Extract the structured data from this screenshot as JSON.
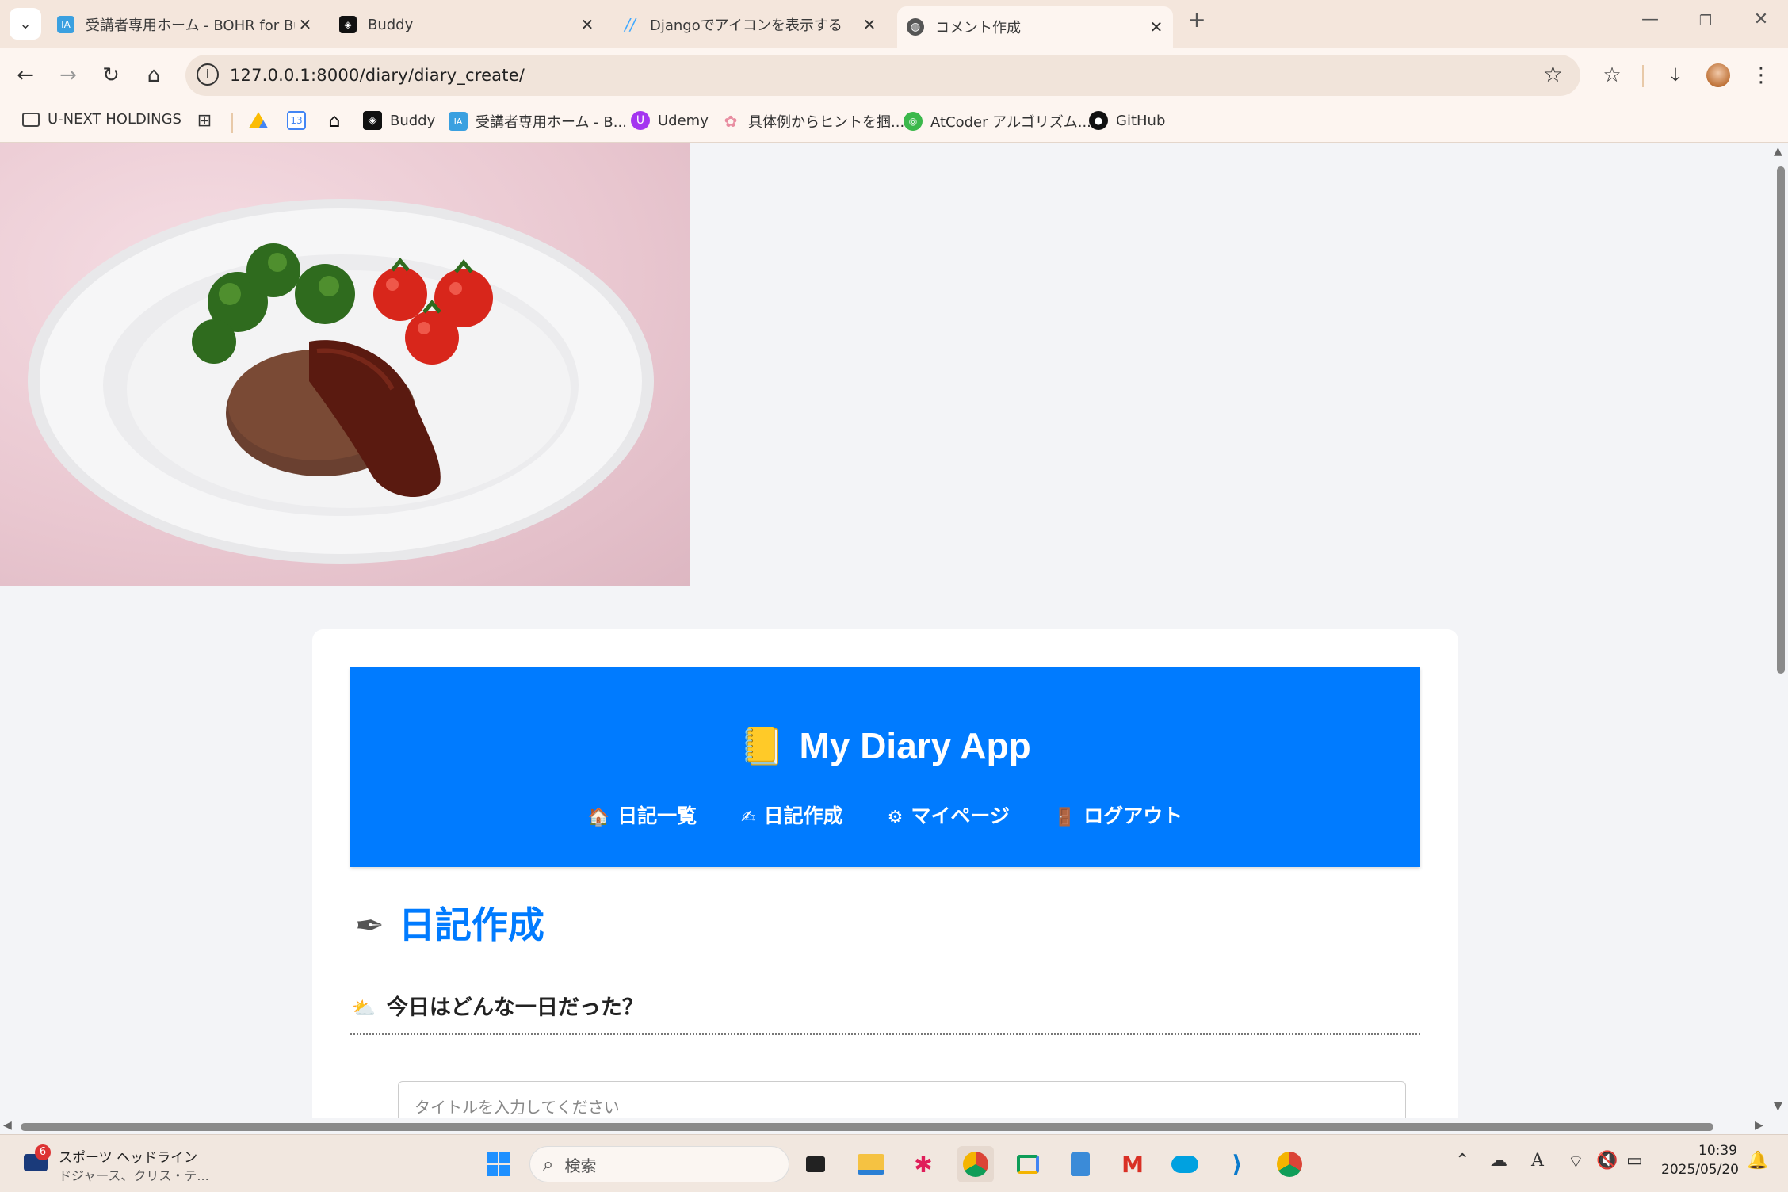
{
  "browser": {
    "tabs": [
      {
        "label": "受講者専用ホーム - BOHR for Bu",
        "favicon": "IA"
      },
      {
        "label": "Buddy",
        "favicon": "buddy-logo"
      },
      {
        "label": "Djangoでアイコンを表示する",
        "favicon": "zenn-logo"
      },
      {
        "label": "コメント作成",
        "favicon": "globe-icon"
      }
    ],
    "new_tab": "+",
    "url": "127.0.0.1:8000/diary/diary_create/",
    "bookmarks": [
      {
        "label": "U-NEXT HOLDINGS",
        "icon": "folder-icon"
      },
      {
        "label": "",
        "icon": "apps-grid-icon"
      },
      {
        "label": "",
        "icon": "google-drive-icon"
      },
      {
        "label": "",
        "icon": "calendar-icon",
        "text": "13"
      },
      {
        "label": "",
        "icon": "home-icon"
      },
      {
        "label": "Buddy",
        "icon": "buddy-logo"
      },
      {
        "label": "受講者専用ホーム - B...",
        "icon": "IA"
      },
      {
        "label": "Udemy",
        "icon": "udemy-icon"
      },
      {
        "label": "具体例からヒントを掴...",
        "icon": "flower-icon"
      },
      {
        "label": "AtCoder アルゴリズム...",
        "icon": "atcoder-icon"
      },
      {
        "label": "GitHub",
        "icon": "github-icon"
      }
    ]
  },
  "app": {
    "title_icon": "📒",
    "title": "My Diary App",
    "nav": [
      {
        "icon": "🏠",
        "label": "日記一覧"
      },
      {
        "icon": "✍",
        "label": "日記作成"
      },
      {
        "icon": "⚙",
        "label": "マイページ"
      },
      {
        "icon": "🚪",
        "label": "ログアウト"
      }
    ],
    "heading_icon": "✒",
    "heading": "日記作成",
    "subheading_icon": "⛅",
    "subheading": "今日はどんな一日だった？",
    "title_placeholder": "タイトルを入力してください"
  },
  "taskbar": {
    "news_badge": "6",
    "news_title": "スポーツ ヘッドライン",
    "news_sub": "ドジャース、クリス・テ...",
    "search_placeholder": "検索",
    "time": "10:39",
    "date": "2025/05/20",
    "ime": "A"
  },
  "colors": {
    "accent": "#007bff",
    "tabstrip": "#f4e6dc",
    "toolbar": "#fdf5f0"
  }
}
